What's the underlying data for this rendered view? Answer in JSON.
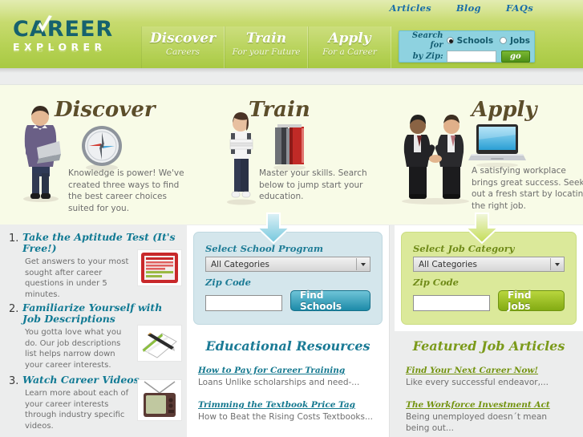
{
  "header": {
    "logo": {
      "line1": "CAREER",
      "line2": "EXPLORER",
      "check_icon": "check-icon"
    },
    "toplinks": [
      {
        "label": "Articles"
      },
      {
        "label": "Blog"
      },
      {
        "label": "FAQs"
      }
    ],
    "nav": [
      {
        "big": "Discover",
        "small": "Careers"
      },
      {
        "big": "Train",
        "small": "For your Future"
      },
      {
        "big": "Apply",
        "small": "For a Career"
      }
    ],
    "search": {
      "label_line1": "Search for",
      "label_line2": "by Zip:",
      "radio_schools": "Schools",
      "radio_jobs": "Jobs",
      "selected": "Schools",
      "zip_value": "",
      "zip_placeholder": "",
      "go_label": "go"
    }
  },
  "hero": [
    {
      "title": "Discover",
      "text": "Knowledge is power! We've created three ways to find the best career choices suited for you.",
      "icon": "compass-icon",
      "figure": "man-with-laptop-photo"
    },
    {
      "title": "Train",
      "text": "Master your skills. Search below to jump start your education.",
      "icon": "books-icon",
      "figure": "woman-with-books-photo"
    },
    {
      "title": "Apply",
      "text": "A satisfying workplace brings great success. Seek out a fresh start by locating the right job.",
      "icon": "laptop-icon",
      "figure": "handshake-photo"
    }
  ],
  "steps": [
    {
      "num": "1.",
      "title": "Take the Aptitude Test (It's Free!)",
      "desc": "Get answers to your most sought after career questions in under 5 minutes.",
      "thumb": "aptitude-test-form-thumbnail"
    },
    {
      "num": "2.",
      "title": "Familiarize Yourself with Job Descriptions",
      "desc": "You gotta love what you do. Our job descriptions list helps narrow down your career interests.",
      "thumb": "notepad-pen-thumbnail"
    },
    {
      "num": "3.",
      "title": "Watch Career Videos",
      "desc": "Learn more about each of your career interests through industry specific videos.",
      "thumb": "television-thumbnail"
    }
  ],
  "school_panel": {
    "select_label": "Select School Program",
    "select_value": "All Categories",
    "zip_label": "Zip Code",
    "zip_value": "",
    "button_label": "Find Schools",
    "arrow_icon": "down-arrow-icon"
  },
  "job_panel": {
    "select_label": "Select Job Category",
    "select_value": "All Categories",
    "zip_label": "Zip Code",
    "zip_value": "",
    "button_label": "Find Jobs",
    "arrow_icon": "down-arrow-icon"
  },
  "edu_resources": {
    "title": "Educational Resources",
    "items": [
      {
        "link": "How to Pay for Career Training",
        "blurb": "Loans Unlike scholarships and need-..."
      },
      {
        "link": "Trimming the Textbook Price Tag",
        "blurb": "How to Beat the Rising Costs Textbooks..."
      }
    ]
  },
  "job_articles": {
    "title": "Featured Job Articles",
    "items": [
      {
        "link": "Find Your Next Career Now!",
        "blurb": "Like every successful endeavor,..."
      },
      {
        "link": "The Workforce Investment Act",
        "blurb": "Being unemployed doesn´t mean being out..."
      }
    ]
  },
  "colors": {
    "header_green": "#b5d153",
    "hero_cream": "#f8fbe7",
    "panel_blue": "#d4e6ec",
    "panel_green": "#dbe99a",
    "teal_text": "#117a94",
    "olive_text": "#7b9a1a",
    "page_gray": "#eceded"
  }
}
